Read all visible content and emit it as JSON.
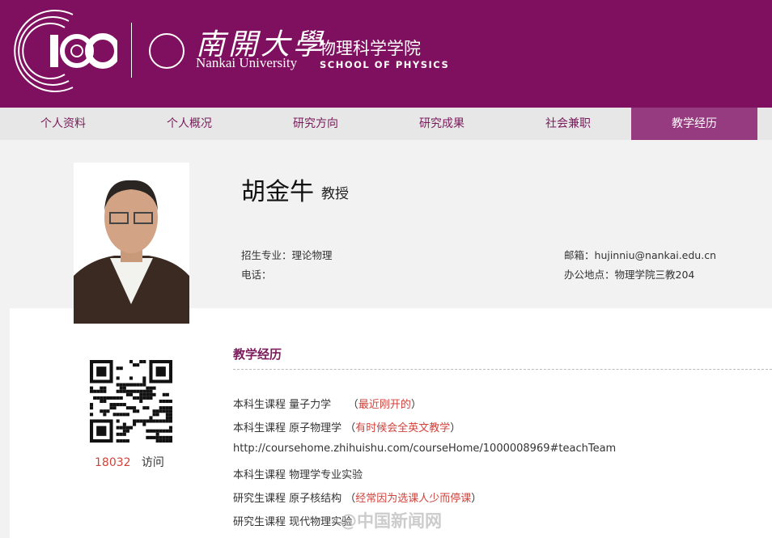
{
  "header": {
    "anniversary_logo": "100",
    "university_cn": "南開大學",
    "university_en": "Nankai University",
    "school_cn": "物理科学学院",
    "school_en": "SCHOOL OF PHYSICS",
    "bg_color": "#7f0f5f"
  },
  "nav": {
    "tabs": [
      {
        "label": "个人资料"
      },
      {
        "label": "个人概况"
      },
      {
        "label": "研究方向"
      },
      {
        "label": "研究成果"
      },
      {
        "label": "社会兼职"
      },
      {
        "label": "教学经历",
        "active": true
      }
    ]
  },
  "profile": {
    "name": "胡金牛",
    "title": "教授",
    "major_label": "招生专业：",
    "major": "理论物理",
    "phone_label": "电话：",
    "phone": "",
    "email_label": "邮箱：",
    "email": "hujinniu@nankai.edu.cn",
    "office_label": "办公地点：",
    "office": "物理学院三教204"
  },
  "sidebar": {
    "visits": "18032",
    "visits_label": "访问"
  },
  "section": {
    "title": "教学经历",
    "lines": [
      {
        "text": "本科生课程 量子力学",
        "note": "最近刚开的"
      },
      {
        "text": "本科生课程 原子物理学",
        "note": "有时候会全英文教学"
      },
      {
        "text": "http://coursehome.zhihuishu.com/courseHome/1000008969#teachTeam",
        "note": null
      },
      {
        "text": "本科生课程 物理学专业实验",
        "note": null
      },
      {
        "text": "研究生课程 原子核结构",
        "note": "经常因为选课人少而停课"
      },
      {
        "text": "研究生课程 现代物理实验",
        "note": null
      }
    ]
  },
  "watermark": "@中国新闻网"
}
